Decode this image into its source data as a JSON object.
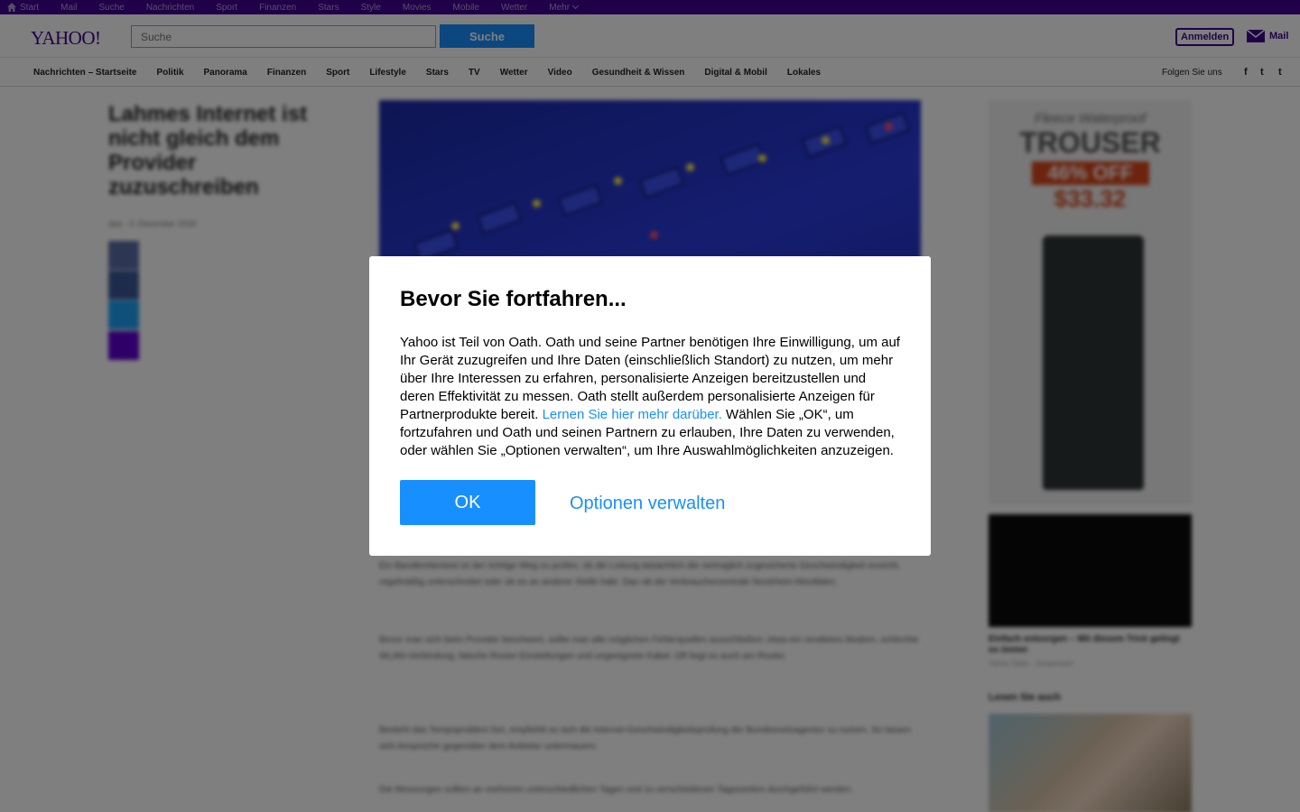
{
  "topbar": {
    "items": [
      "Start",
      "Mail",
      "Suche",
      "Nachrichten",
      "Sport",
      "Finanzen",
      "Stars",
      "Style",
      "Movies",
      "Mobile",
      "Wetter",
      "Mehr"
    ]
  },
  "header": {
    "logo": "YAHOO!",
    "search_placeholder": "Suche",
    "search_button": "Suche",
    "signin": "Anmelden",
    "mail": "Mail"
  },
  "nav": {
    "items": [
      "Nachrichten – Startseite",
      "Politik",
      "Panorama",
      "Finanzen",
      "Sport",
      "Lifestyle",
      "Stars",
      "TV",
      "Wetter",
      "Video",
      "Gesundheit & Wissen",
      "Digital & Mobil",
      "Lokales"
    ],
    "follow": "Folgen Sie uns",
    "social": [
      "f",
      "t",
      "t"
    ]
  },
  "article": {
    "headline": "Lahmes Internet ist nicht gleich dem Provider zuzuschreiben",
    "byline": "dpa · 3. Dezember 2018",
    "paragraphs": [
      "Ein Bandbreitentest ist der richtige Weg zu prüfen, ob die Leitung tatsächlich die vertraglich zugesicherte Geschwindigkeit erreicht, regelmäßig unterschreitet oder ob es an anderer Stelle hakt. Das rät die Verbraucherzentrale Nordrhein-Westfalen.",
      "Bevor man sich beim Provider beschwert, sollte man alle möglichen Fehlerquellen ausschließen: etwa ein veraltetes Modem, schlechte WLAN-Verbindung, falsche Router-Einstellungen und ungeeignete Kabel. Oft liegt es auch am Router.",
      "Besteht das Tempoproblem fort, empfiehlt es sich die Internet-Geschwindigkeitsprüfung der Bundesnetzagentur zu nutzen. So lassen sich Ansprüche gegenüber dem Anbieter untermauern.",
      "Die Messungen sollten an mehreren unterschiedlichen Tagen und zu verschiedenen Tageszeiten durchgeführt werden."
    ]
  },
  "sidebar": {
    "ad_line1": "Fleece Waterproof",
    "ad_line2": "TROUSER",
    "ad_line3": "46% OFF",
    "ad_line4": "$33.32",
    "video_caption": "Einfach entsorgen – Mit diesem Trick gelingt es immer",
    "video_source": "Yahoo Video · Gesponsert",
    "readmore": "Lesen Sie auch"
  },
  "dialog": {
    "title": "Bevor Sie fortfahren...",
    "body_before_link": "Yahoo ist Teil von Oath. Oath und seine Partner benötigen Ihre Einwilligung, um auf Ihr Gerät zuzugreifen und Ihre Daten (einschließlich Standort) zu nutzen, um mehr über Ihre Interessen zu erfahren, personalisierte Anzeigen bereitzustellen und deren Effektivität zu messen. Oath stellt außerdem personalisierte Anzeigen für Partnerprodukte bereit. ",
    "link_text": "Lernen Sie hier mehr darüber.",
    "body_after_link": " Wählen Sie „OK“, um fortzufahren und Oath und seinen Partnern zu erlauben, Ihre Daten zu verwenden, oder wählen Sie „Optionen verwalten“, um Ihre Auswahlmöglichkeiten anzuzeigen.",
    "ok_label": "OK",
    "options_label": "Optionen verwalten"
  },
  "colors": {
    "brand_purple": "#400090",
    "accent_blue": "#188fff"
  }
}
